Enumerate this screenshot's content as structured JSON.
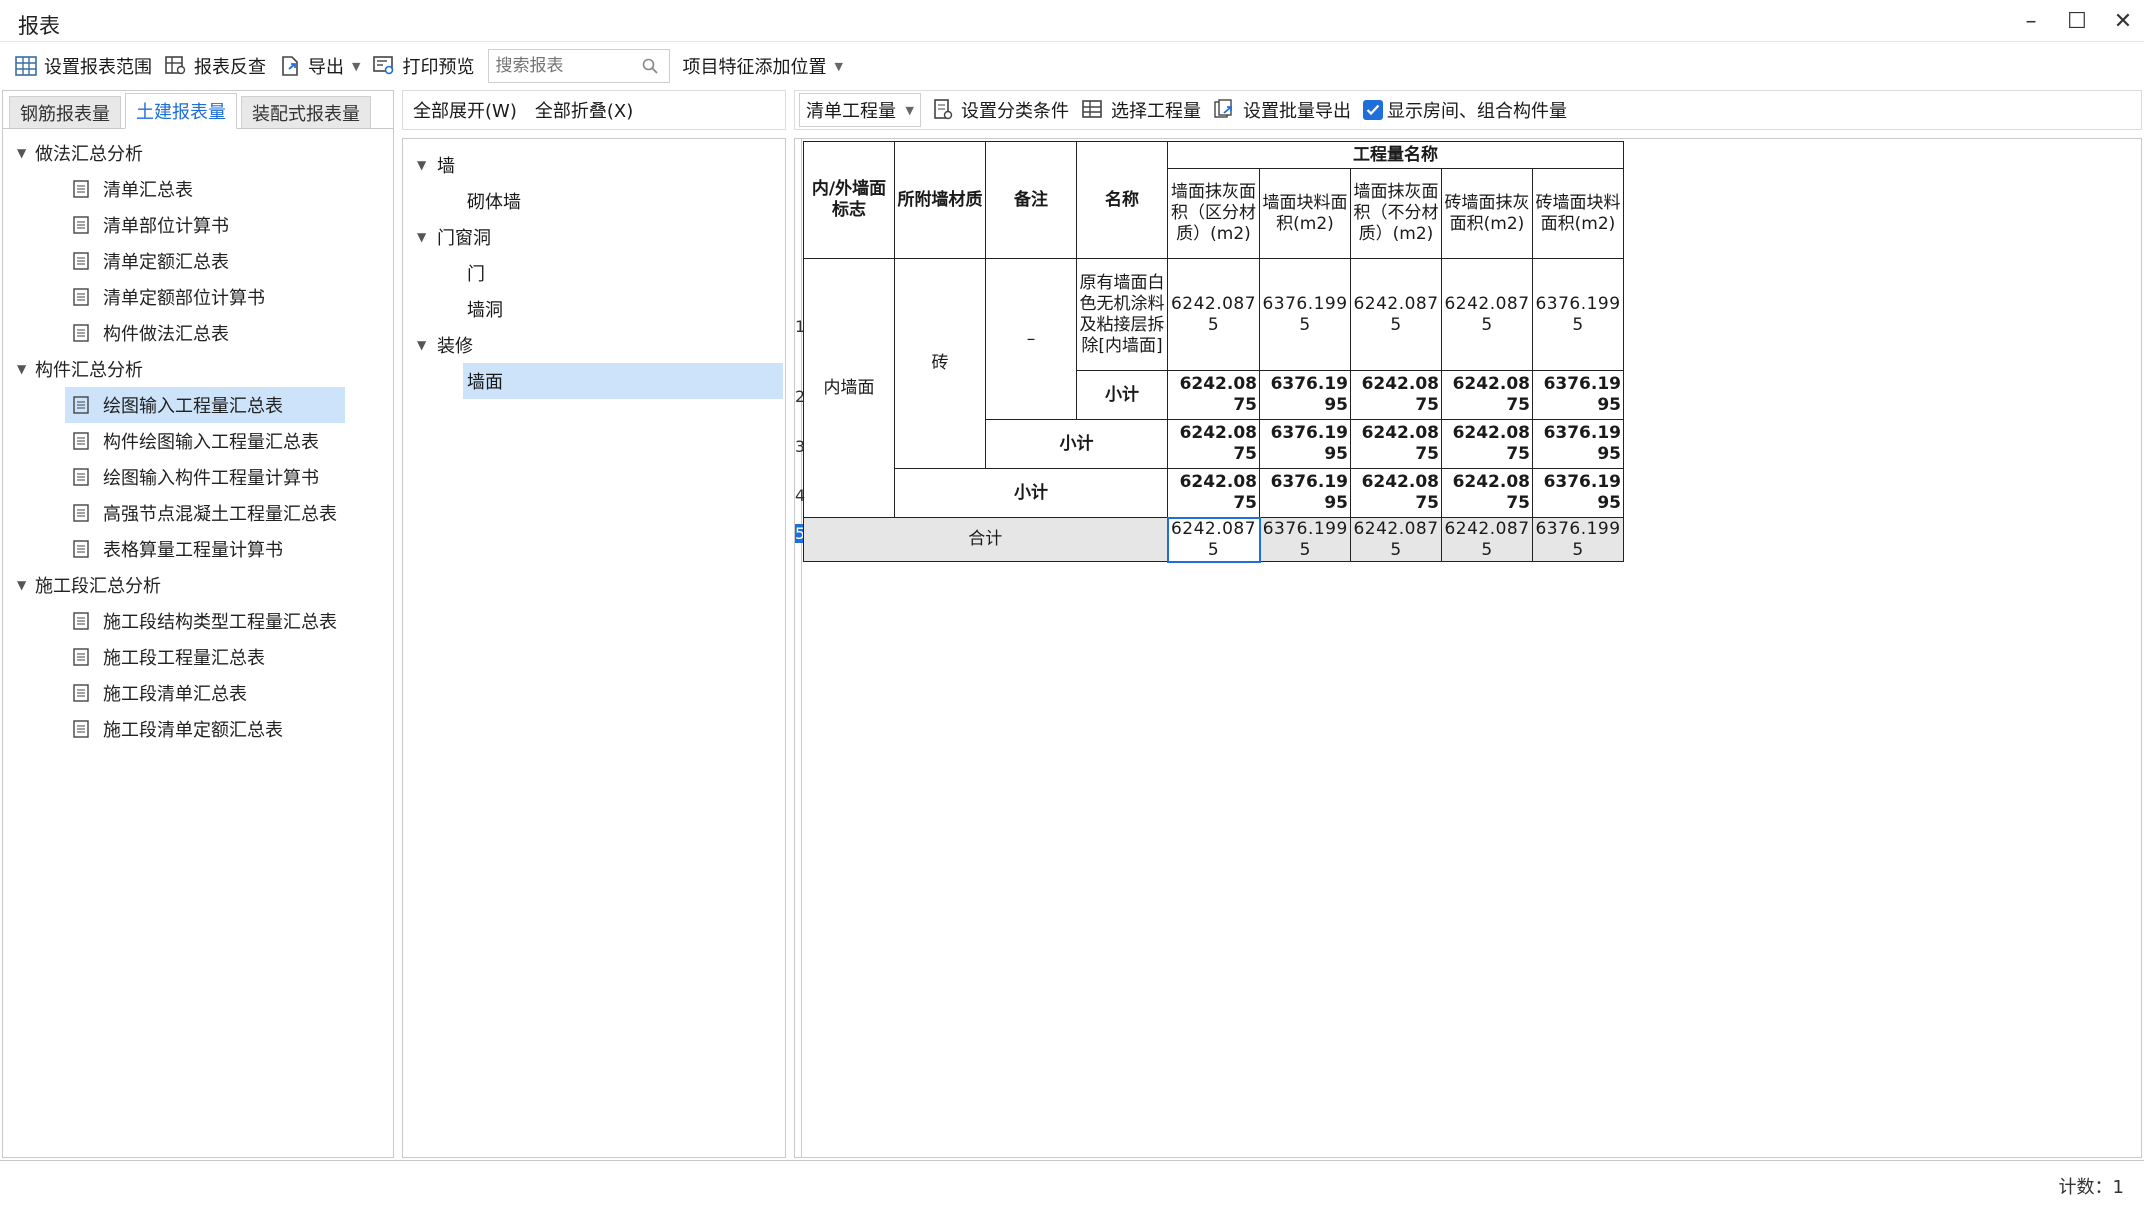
{
  "window": {
    "title": "报表"
  },
  "toolbar": {
    "set_range": "设置报表范围",
    "reverse_check": "报表反查",
    "export": "导出",
    "print_preview": "打印预览",
    "search_placeholder": "搜索报表",
    "feature_position": "项目特征添加位置"
  },
  "left_tabs": [
    "钢筋报表量",
    "土建报表量",
    "装配式报表量"
  ],
  "left_tree": {
    "group1": "做法汇总分析",
    "group1_items": [
      "清单汇总表",
      "清单部位计算书",
      "清单定额汇总表",
      "清单定额部位计算书",
      "构件做法汇总表"
    ],
    "group2": "构件汇总分析",
    "group2_items": [
      "绘图输入工程量汇总表",
      "构件绘图输入工程量汇总表",
      "绘图输入构件工程量计算书",
      "高强节点混凝土工程量汇总表",
      "表格算量工程量计算书"
    ],
    "group3": "施工段汇总分析",
    "group3_items": [
      "施工段结构类型工程量汇总表",
      "施工段工程量汇总表",
      "施工段清单汇总表",
      "施工段清单定额汇总表"
    ]
  },
  "middle": {
    "expand_all": "全部展开(W)",
    "collapse_all": "全部折叠(X)",
    "groups": [
      {
        "label": "墙",
        "items": [
          "砌体墙"
        ]
      },
      {
        "label": "门窗洞",
        "items": [
          "门",
          "墙洞"
        ]
      },
      {
        "label": "装修",
        "items": [
          "墙面"
        ]
      }
    ]
  },
  "right_toolbar": {
    "select_value": "清单工程量",
    "set_classify": "设置分类条件",
    "select_quantity": "选择工程量",
    "batch_export": "设置批量导出",
    "show_rooms": "显示房间、组合构件量"
  },
  "table": {
    "col_headers": {
      "inout": "内/外墙面标志",
      "material": "所附墙材质",
      "remark": "备注",
      "name": "名称",
      "quantity_group": "工程量名称",
      "q1": "墙面抹灰面积（区分材质）(m2)",
      "q2": "墙面块料面积(m2)",
      "q3": "墙面抹灰面积（不分材质）(m2)",
      "q4": "砖墙面抹灰面积(m2)",
      "q5": "砖墙面块料面积(m2)"
    },
    "row_numbers": [
      "1",
      "2",
      "3",
      "4",
      "5"
    ],
    "inout_value": "内墙面",
    "material_value": "砖",
    "remark_value": "–",
    "name_value": "原有墙面白色无机涂料及粘接层拆除[内墙面]",
    "subtotal_label": "小计",
    "total_label": "合计",
    "row1": [
      "6242.0875",
      "6376.1995",
      "6242.0875",
      "6242.0875",
      "6376.1995"
    ],
    "row2": [
      "6242.0875",
      "6376.1995",
      "6242.0875",
      "6242.0875",
      "6376.1995"
    ],
    "row3": [
      "6242.0875",
      "6376.1995",
      "6242.0875",
      "6242.0875",
      "6376.1995"
    ],
    "row4": [
      "6242.0875",
      "6376.1995",
      "6242.0875",
      "6242.0875",
      "6376.1995"
    ],
    "row5": [
      "6242.0875",
      "6376.1995",
      "6242.0875",
      "6242.0875",
      "6376.1995"
    ]
  },
  "status": {
    "count": "计数：1"
  }
}
